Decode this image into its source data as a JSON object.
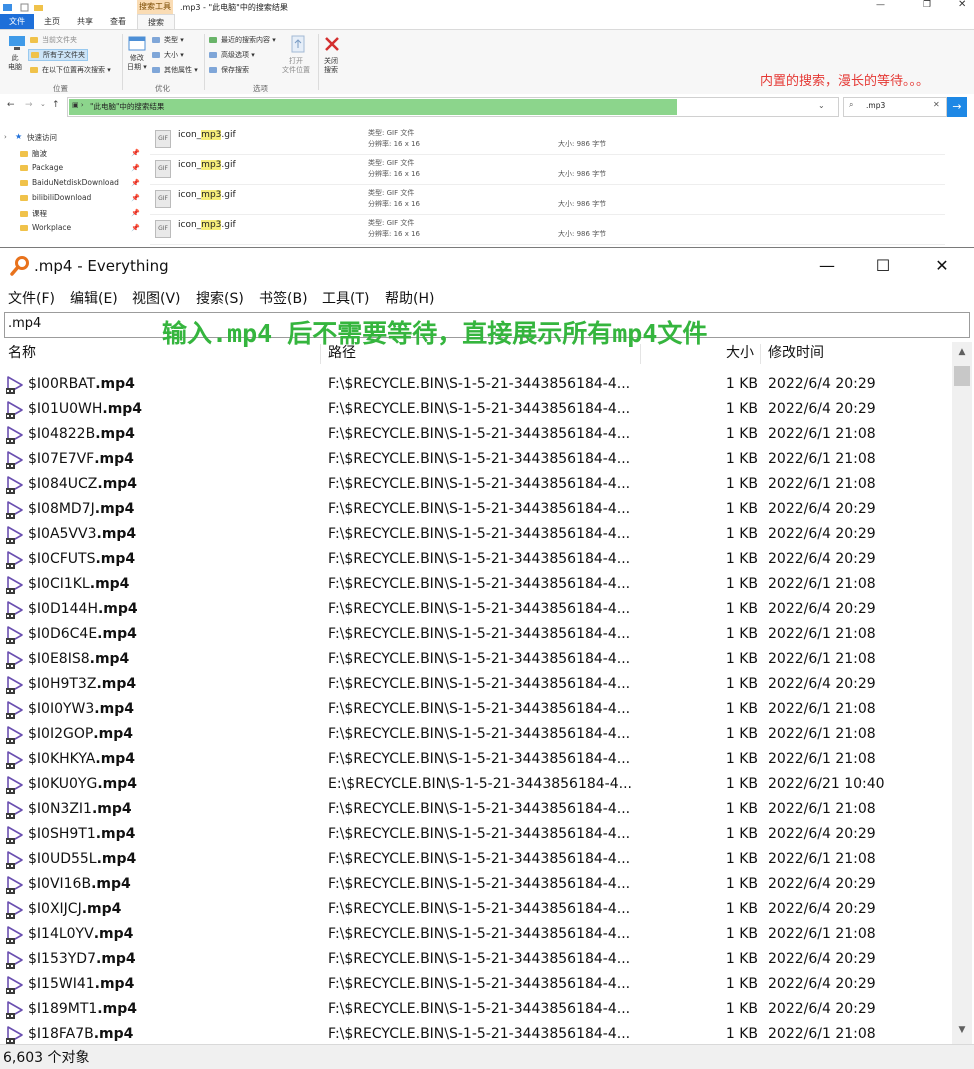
{
  "explorer": {
    "title": ".mp3 - \"此电脑\"中的搜索结果",
    "context_tab_label": "搜索工具",
    "tabs": [
      "文件",
      "主页",
      "共享",
      "查看",
      "搜索"
    ],
    "ribbon": {
      "this_pc": "此\n电脑",
      "current_folder": "当前文件夹",
      "all_subfolders": "所有子文件夹",
      "search_again_in": "在以下位置再次搜索",
      "location_group": "位置",
      "modified_date": "修改\n日期",
      "type": "类型",
      "size": "大小",
      "other_props": "其他属性",
      "refine_group": "优化",
      "recent_searches": "最近的搜索内容",
      "advanced_options": "高级选项",
      "save_search": "保存搜索",
      "open_file_location": "打开\n文件位置",
      "options_group": "选项",
      "close_search": "关闭\n搜索"
    },
    "annotation_red": "内置的搜索，漫长的等待。。。",
    "address": "\"此电脑\"中的搜索结果",
    "search_value": ".mp3",
    "nav": {
      "quick_access": "快速访问",
      "items": [
        "脑波",
        "Package",
        "BaiduNetdiskDownload",
        "bilibiliDownload",
        "课程",
        "Workplace"
      ]
    },
    "files": [
      {
        "name_pre": "icon_",
        "name_hl": "mp3",
        "name_post": ".gif",
        "type": "类型: GIF 文件",
        "res": "分辨率: 16 x 16",
        "size": "大小: 986 字节"
      },
      {
        "name_pre": "icon_",
        "name_hl": "mp3",
        "name_post": ".gif",
        "type": "类型: GIF 文件",
        "res": "分辨率: 16 x 16",
        "size": "大小: 986 字节"
      },
      {
        "name_pre": "icon_",
        "name_hl": "mp3",
        "name_post": ".gif",
        "type": "类型: GIF 文件",
        "res": "分辨率: 16 x 16",
        "size": "大小: 986 字节"
      },
      {
        "name_pre": "icon_",
        "name_hl": "mp3",
        "name_post": ".gif",
        "type": "类型: GIF 文件",
        "res": "分辨率: 16 x 16",
        "size": "大小: 986 字节"
      }
    ]
  },
  "everything": {
    "title": ".mp4 - Everything",
    "menu": [
      "文件(F)",
      "编辑(E)",
      "视图(V)",
      "搜索(S)",
      "书签(B)",
      "工具(T)",
      "帮助(H)"
    ],
    "search_value": ".mp4",
    "annotation_green": "输入.mp4 后不需要等待，直接展示所有mp4文件",
    "columns": {
      "name": "名称",
      "path": "路径",
      "size": "大小",
      "modified": "修改时间"
    },
    "rows": [
      {
        "stem": "$I00RBAT",
        "ext": ".mp4",
        "path": "F:\\$RECYCLE.BIN\\S-1-5-21-3443856184-4...",
        "size": "1 KB",
        "date": "2022/6/4 20:29"
      },
      {
        "stem": "$I01U0WH",
        "ext": ".mp4",
        "path": "F:\\$RECYCLE.BIN\\S-1-5-21-3443856184-4...",
        "size": "1 KB",
        "date": "2022/6/4 20:29"
      },
      {
        "stem": "$I04822B",
        "ext": ".mp4",
        "path": "F:\\$RECYCLE.BIN\\S-1-5-21-3443856184-4...",
        "size": "1 KB",
        "date": "2022/6/1 21:08"
      },
      {
        "stem": "$I07E7VF",
        "ext": ".mp4",
        "path": "F:\\$RECYCLE.BIN\\S-1-5-21-3443856184-4...",
        "size": "1 KB",
        "date": "2022/6/1 21:08"
      },
      {
        "stem": "$I084UCZ",
        "ext": ".mp4",
        "path": "F:\\$RECYCLE.BIN\\S-1-5-21-3443856184-4...",
        "size": "1 KB",
        "date": "2022/6/1 21:08"
      },
      {
        "stem": "$I08MD7J",
        "ext": ".mp4",
        "path": "F:\\$RECYCLE.BIN\\S-1-5-21-3443856184-4...",
        "size": "1 KB",
        "date": "2022/6/4 20:29"
      },
      {
        "stem": "$I0A5VV3",
        "ext": ".mp4",
        "path": "F:\\$RECYCLE.BIN\\S-1-5-21-3443856184-4...",
        "size": "1 KB",
        "date": "2022/6/4 20:29"
      },
      {
        "stem": "$I0CFUTS",
        "ext": ".mp4",
        "path": "F:\\$RECYCLE.BIN\\S-1-5-21-3443856184-4...",
        "size": "1 KB",
        "date": "2022/6/4 20:29"
      },
      {
        "stem": "$I0CI1KL",
        "ext": ".mp4",
        "path": "F:\\$RECYCLE.BIN\\S-1-5-21-3443856184-4...",
        "size": "1 KB",
        "date": "2022/6/1 21:08"
      },
      {
        "stem": "$I0D144H",
        "ext": ".mp4",
        "path": "F:\\$RECYCLE.BIN\\S-1-5-21-3443856184-4...",
        "size": "1 KB",
        "date": "2022/6/4 20:29"
      },
      {
        "stem": "$I0D6C4E",
        "ext": ".mp4",
        "path": "F:\\$RECYCLE.BIN\\S-1-5-21-3443856184-4...",
        "size": "1 KB",
        "date": "2022/6/1 21:08"
      },
      {
        "stem": "$I0E8IS8",
        "ext": ".mp4",
        "path": "F:\\$RECYCLE.BIN\\S-1-5-21-3443856184-4...",
        "size": "1 KB",
        "date": "2022/6/1 21:08"
      },
      {
        "stem": "$I0H9T3Z",
        "ext": ".mp4",
        "path": "F:\\$RECYCLE.BIN\\S-1-5-21-3443856184-4...",
        "size": "1 KB",
        "date": "2022/6/4 20:29"
      },
      {
        "stem": "$I0I0YW3",
        "ext": ".mp4",
        "path": "F:\\$RECYCLE.BIN\\S-1-5-21-3443856184-4...",
        "size": "1 KB",
        "date": "2022/6/1 21:08"
      },
      {
        "stem": "$I0I2GOP",
        "ext": ".mp4",
        "path": "F:\\$RECYCLE.BIN\\S-1-5-21-3443856184-4...",
        "size": "1 KB",
        "date": "2022/6/1 21:08"
      },
      {
        "stem": "$I0KHKYA",
        "ext": ".mp4",
        "path": "F:\\$RECYCLE.BIN\\S-1-5-21-3443856184-4...",
        "size": "1 KB",
        "date": "2022/6/1 21:08"
      },
      {
        "stem": "$I0KU0YG",
        "ext": ".mp4",
        "path": "E:\\$RECYCLE.BIN\\S-1-5-21-3443856184-4...",
        "size": "1 KB",
        "date": "2022/6/21 10:40"
      },
      {
        "stem": "$I0N3ZI1",
        "ext": ".mp4",
        "path": "F:\\$RECYCLE.BIN\\S-1-5-21-3443856184-4...",
        "size": "1 KB",
        "date": "2022/6/1 21:08"
      },
      {
        "stem": "$I0SH9T1",
        "ext": ".mp4",
        "path": "F:\\$RECYCLE.BIN\\S-1-5-21-3443856184-4...",
        "size": "1 KB",
        "date": "2022/6/4 20:29"
      },
      {
        "stem": "$I0UD55L",
        "ext": ".mp4",
        "path": "F:\\$RECYCLE.BIN\\S-1-5-21-3443856184-4...",
        "size": "1 KB",
        "date": "2022/6/1 21:08"
      },
      {
        "stem": "$I0VI16B",
        "ext": ".mp4",
        "path": "F:\\$RECYCLE.BIN\\S-1-5-21-3443856184-4...",
        "size": "1 KB",
        "date": "2022/6/4 20:29"
      },
      {
        "stem": "$I0XIJCJ",
        "ext": ".mp4",
        "path": "F:\\$RECYCLE.BIN\\S-1-5-21-3443856184-4...",
        "size": "1 KB",
        "date": "2022/6/4 20:29"
      },
      {
        "stem": "$I14L0YV",
        "ext": ".mp4",
        "path": "F:\\$RECYCLE.BIN\\S-1-5-21-3443856184-4...",
        "size": "1 KB",
        "date": "2022/6/1 21:08"
      },
      {
        "stem": "$I153YD7",
        "ext": ".mp4",
        "path": "F:\\$RECYCLE.BIN\\S-1-5-21-3443856184-4...",
        "size": "1 KB",
        "date": "2022/6/4 20:29"
      },
      {
        "stem": "$I15WI41",
        "ext": ".mp4",
        "path": "F:\\$RECYCLE.BIN\\S-1-5-21-3443856184-4...",
        "size": "1 KB",
        "date": "2022/6/4 20:29"
      },
      {
        "stem": "$I189MT1",
        "ext": ".mp4",
        "path": "F:\\$RECYCLE.BIN\\S-1-5-21-3443856184-4...",
        "size": "1 KB",
        "date": "2022/6/4 20:29"
      },
      {
        "stem": "$I18FA7B",
        "ext": ".mp4",
        "path": "F:\\$RECYCLE.BIN\\S-1-5-21-3443856184-4...",
        "size": "1 KB",
        "date": "2022/6/1 21:08"
      }
    ],
    "status": "6,603 个对象"
  },
  "colors": {
    "annotation_red": "#e53935",
    "annotation_green": "#35b53e",
    "address_highlight": "#8cd58c",
    "search_tools_tab": "#fadcb4",
    "file_tab": "#1e6fd9",
    "video_icon": "#6a4fb0"
  },
  "icons": {
    "everything_logo": "magnifier-icon",
    "video_file": "video-file-icon"
  }
}
